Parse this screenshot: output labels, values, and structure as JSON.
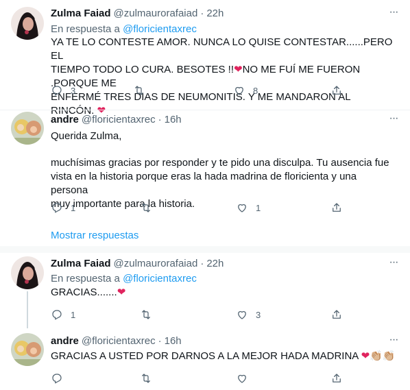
{
  "tweets": [
    {
      "name": "Zulma Faiad",
      "handle": "@zulmaurorafaiad",
      "time": "22h",
      "avatar": "zulma-avatar",
      "reply_prefix": "En respuesta a",
      "reply_mention": "@floricientaxrec",
      "lines": [
        "YA TE LO CONTESTE AMOR. NUNCA LO QUISE CONTESTAR......PERO EL",
        "TIEMPO TODO LO CURA. BESOTES !!",
        "NO ME FUÍ ME FUERON .PORQUE ME",
        "ENFERMÉ TRES DIAS DE NEUMONITIS. Y ME MANDARON AL RINCÓN."
      ],
      "replies": "3",
      "retweets": "",
      "likes": "8"
    },
    {
      "name": "andre",
      "handle": "@floricientaxrec",
      "time": "16h",
      "avatar": "andre-avatar",
      "paragraphs": [
        "Querida Zulma,",
        "muchísimas gracias por responder y te pido una disculpa. Tu ausencia fue",
        "vista en la historia porque eras la hada madrina de floricienta y una persona",
        "muy importante para la historia."
      ],
      "replies": "1",
      "retweets": "",
      "likes": "1"
    },
    {
      "name": "Zulma Faiad",
      "handle": "@zulmaurorafaiad",
      "time": "22h",
      "avatar": "zulma-avatar",
      "reply_prefix": "En respuesta a",
      "reply_mention": "@floricientaxrec",
      "text": "GRACIAS.......",
      "replies": "1",
      "retweets": "",
      "likes": "3"
    },
    {
      "name": "andre",
      "handle": "@floricientaxrec",
      "time": "16h",
      "avatar": "andre-avatar",
      "text": "GRACIAS A USTED POR DARNOS A LA MEJOR HADA MADRINA",
      "emoji": "❤👏🏼👏🏼",
      "replies": "",
      "retweets": "",
      "likes": ""
    }
  ],
  "show_replies_label": "Mostrar respuestas",
  "icons": [
    "reply-icon",
    "retweet-icon",
    "like-icon",
    "share-icon",
    "more-icon",
    "heart-emoji-icon",
    "clap-emoji-icon"
  ],
  "colors": {
    "link": "#1d9bf0",
    "secondary_text": "#536471",
    "heart": "#e0245e",
    "thread_line": "#cfd9de"
  }
}
